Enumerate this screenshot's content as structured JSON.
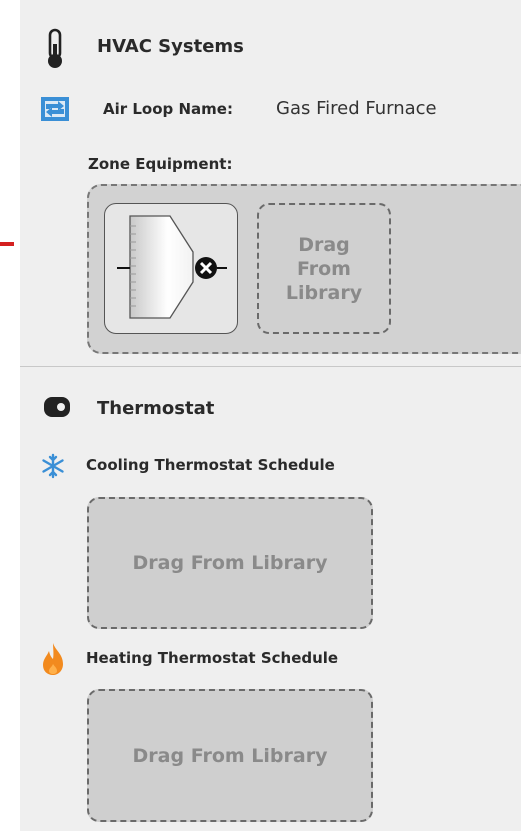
{
  "hvac": {
    "title": "HVAC Systems",
    "icon": "thermometer-icon",
    "air_loop_label": "Air Loop Name:",
    "air_loop_value": "Gas Fired Furnace",
    "air_loop_icon": "air-loop-icon",
    "zone_equipment_label": "Zone Equipment:",
    "zone_equipment_icon": "air-terminal-icon",
    "drag_from_library_label": "Drag From Library"
  },
  "thermostat": {
    "title": "Thermostat",
    "icon": "thermostat-icon",
    "cooling_label": "Cooling Thermostat Schedule",
    "cooling_icon": "snowflake-icon",
    "cooling_drop_label": "Drag From Library",
    "heating_label": "Heating Thermostat Schedule",
    "heating_icon": "flame-icon",
    "heating_drop_label": "Drag From Library"
  },
  "colors": {
    "panel_bg": "#efefef",
    "dropzone_bg": "#cfcfcf",
    "arrow_red": "#d42020",
    "cooling_blue": "#3a8fd6",
    "heating_orange": "#f28a1e"
  }
}
